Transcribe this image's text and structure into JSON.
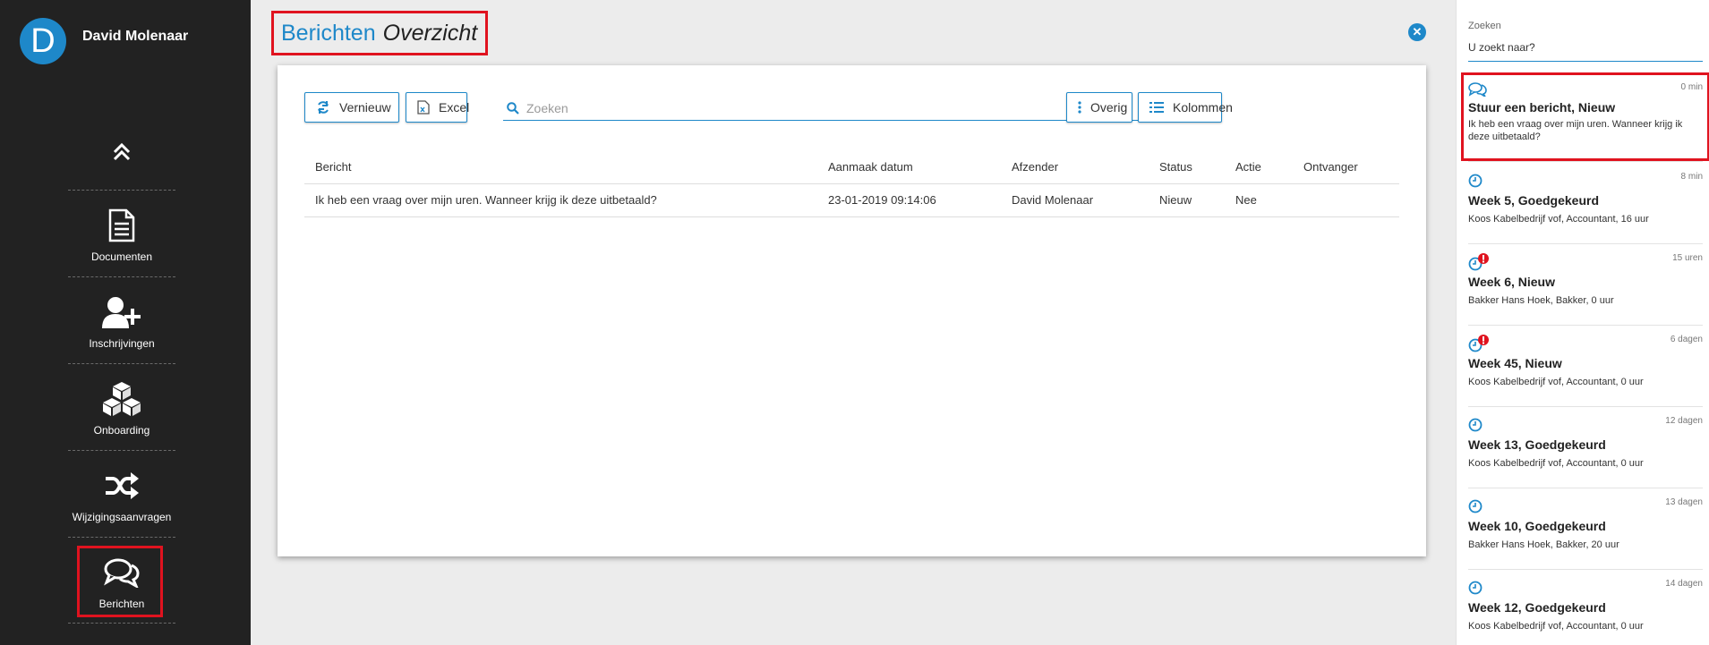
{
  "user": {
    "initial": "D",
    "name": "David Molenaar"
  },
  "sidebar": {
    "items": [
      {
        "label": "Documenten",
        "icon": "document-icon"
      },
      {
        "label": "Inschrijvingen",
        "icon": "user-plus-icon"
      },
      {
        "label": "Onboarding",
        "icon": "cubes-icon"
      },
      {
        "label": "Wijzigingsaanvragen",
        "icon": "shuffle-icon"
      },
      {
        "label": "Berichten",
        "icon": "comments-icon",
        "active": true
      }
    ]
  },
  "header": {
    "title": "Berichten",
    "subtitle": "Overzicht"
  },
  "toolbar": {
    "refresh_label": "Vernieuw",
    "excel_label": "Excel",
    "search_placeholder": "Zoeken",
    "other_label": "Overig",
    "columns_label": "Kolommen"
  },
  "table": {
    "columns": [
      "Bericht",
      "Aanmaak datum",
      "Afzender",
      "Status",
      "Actie",
      "Ontvanger"
    ],
    "rows": [
      [
        "Ik heb een vraag over mijn uren. Wanneer krijg ik deze uitbetaald?",
        "23-01-2019 09:14:06",
        "David Molenaar",
        "Nieuw",
        "Nee",
        ""
      ]
    ]
  },
  "right_panel": {
    "search_label": "Zoeken",
    "search_placeholder": "U zoekt naar?",
    "notifications": [
      {
        "icon": "comments-icon",
        "time": "0 min",
        "title": "Stuur een bericht, Nieuw",
        "subtitle": "Ik heb een vraag over mijn uren. Wanneer krijg ik deze uitbetaald?"
      },
      {
        "icon": "clock-icon",
        "time": "8 min",
        "title": "Week 5, Goedgekeurd",
        "subtitle": "Koos Kabelbedrijf vof, Accountant, 16 uur"
      },
      {
        "icon": "clock-alert-icon",
        "time": "15 uren",
        "title": "Week 6, Nieuw",
        "subtitle": "Bakker Hans Hoek, Bakker, 0 uur"
      },
      {
        "icon": "clock-alert-icon",
        "time": "6 dagen",
        "title": "Week 45, Nieuw",
        "subtitle": "Koos Kabelbedrijf vof, Accountant, 0 uur"
      },
      {
        "icon": "clock-icon",
        "time": "12 dagen",
        "title": "Week 13, Goedgekeurd",
        "subtitle": "Koos Kabelbedrijf vof, Accountant, 0 uur"
      },
      {
        "icon": "clock-icon",
        "time": "13 dagen",
        "title": "Week 10, Goedgekeurd",
        "subtitle": "Bakker Hans Hoek, Bakker, 20 uur"
      },
      {
        "icon": "clock-icon",
        "time": "14 dagen",
        "title": "Week 12, Goedgekeurd",
        "subtitle": "Koos Kabelbedrijf vof, Accountant, 0 uur"
      }
    ]
  },
  "colors": {
    "accent": "#1e88c9",
    "sidebar_bg": "#222222",
    "highlight": "#e0131f",
    "alert": "#e0131f"
  }
}
